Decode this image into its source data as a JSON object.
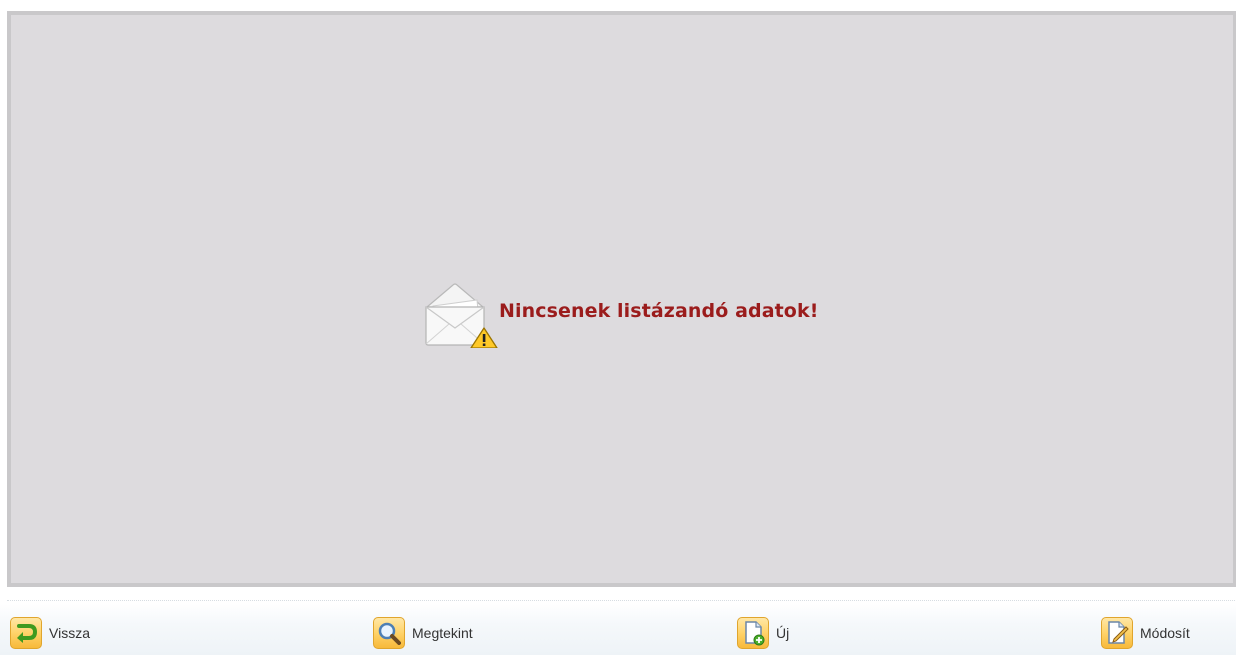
{
  "empty_state": {
    "message": "Nincsenek listázandó adatok!",
    "icon": "envelope-warning-icon",
    "text_color": "#9b1c1c"
  },
  "panel": {
    "background": "#dddbde",
    "border": "#c9c8ca"
  },
  "toolbar": {
    "buttons": [
      {
        "label": "Vissza",
        "icon": "back-arrow-icon"
      },
      {
        "label": "Megtekint",
        "icon": "magnifier-icon"
      },
      {
        "label": "Új",
        "icon": "new-document-icon"
      },
      {
        "label": "Módosít",
        "icon": "edit-document-icon"
      }
    ]
  }
}
